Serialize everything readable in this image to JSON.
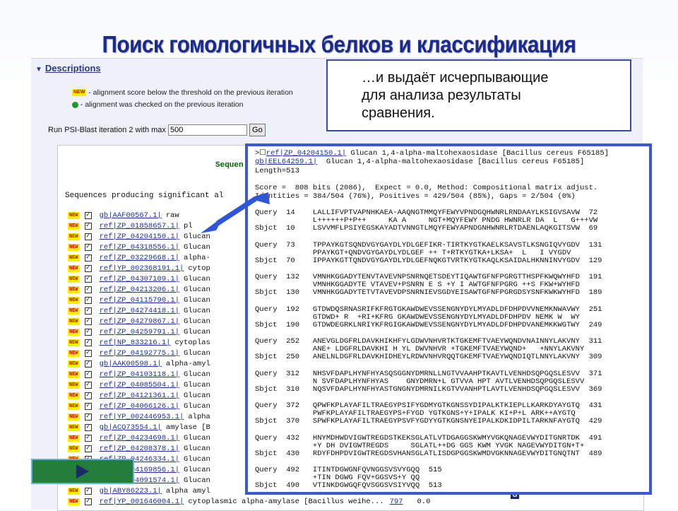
{
  "title": "Поиск гомологичных белков и классификация",
  "descriptions": {
    "label": "Descriptions",
    "legend_new_text": "- alignment score below the threshold on the previous iteration",
    "legend_checked_text": "- alignment was checked on the previous iteration",
    "new_badge": "NEW",
    "psi_label": "Run PSI-Blast iteration 2 with max",
    "psi_value": "500",
    "go_label": "Go"
  },
  "results": {
    "sequences_heading": "Sequen",
    "producing_text": "Sequences producing significant al",
    "hits": [
      {
        "acc": "gb|AAF00567.1|",
        "desc": "raw"
      },
      {
        "acc": "ref|ZP_01858657.1|",
        "desc": "pl"
      },
      {
        "acc": "ref|ZP_04204150.1|",
        "desc": "Glucan"
      },
      {
        "acc": "ref|ZP_04318556.1|",
        "desc": "Glucan"
      },
      {
        "acc": "ref|ZP_03229668.1|",
        "desc": "alpha-"
      },
      {
        "acc": "ref|YP_002368191.1|",
        "desc": "cytop"
      },
      {
        "acc": "ref|ZP_04307109.1|",
        "desc": "Glucan"
      },
      {
        "acc": "ref|ZP_04213206.1|",
        "desc": "Glucan"
      },
      {
        "acc": "ref|ZP_04115790.1|",
        "desc": "Glucan"
      },
      {
        "acc": "ref|ZP_04274418.1|",
        "desc": "Glucan"
      },
      {
        "acc": "ref|ZP_04279867.1|",
        "desc": "Glucan"
      },
      {
        "acc": "ref|ZP_04259791.1|",
        "desc": "Glucan"
      },
      {
        "acc": "ref|NP_833216.1|",
        "desc": "cytoplas"
      },
      {
        "acc": "ref|ZP_04192775.1|",
        "desc": "Glucan"
      },
      {
        "acc": "gb|AAK00598.1|",
        "desc": "alpha-amyl"
      },
      {
        "acc": "ref|ZP_04103118.1|",
        "desc": "Glucan"
      },
      {
        "acc": "ref|ZP_04085504.1|",
        "desc": "Glucan"
      },
      {
        "acc": "ref|ZP_04121361.1|",
        "desc": "Glucan"
      },
      {
        "acc": "ref|ZP_04066126.1|",
        "desc": "Glucan"
      },
      {
        "acc": "ref|YP_002446953.1|",
        "desc": "alpha"
      },
      {
        "acc": "gb|ACQ73554.1|",
        "desc": "amylase [B"
      },
      {
        "acc": "ref|ZP_04234698.1|",
        "desc": "Glucan"
      },
      {
        "acc": "ref|ZP_04208378.1|",
        "desc": "Glucan"
      },
      {
        "acc": "ref|ZP_04246334.1|",
        "desc": "Glucan"
      },
      {
        "acc": "ref|ZP_04169856.1|",
        "desc": "Glucan"
      },
      {
        "acc": "ref|ZP_04091574.1|",
        "desc": "Glucan"
      },
      {
        "acc": "gb|ABY86223.1|",
        "desc": "alpha amyl"
      },
      {
        "acc": "ref|YP_001646004.1|",
        "desc": "cytoplasmic alpha-amylase [Bacillus weihe...",
        "score": "797",
        "evalue": "0.0"
      }
    ]
  },
  "callout": {
    "lines": [
      "…и выдаёт исчерпывающие",
      "для анализа результаты",
      "сравнения."
    ]
  },
  "alignment": {
    "header_prefix": ">",
    "header_acc": "ref|ZP_04204150.1|",
    "header_desc": "Glucan 1,4-alpha-maltohexaosidase [Bacillus cereus F65185]",
    "gb_acc": "gb|EEL64259.1|",
    "gb_desc": "Glucan 1,4-alpha-maltohexaosidase [Bacillus cereus F65185]",
    "length": "Length=513",
    "score_line": "Score =  808 bits (2086),  Expect = 0.0, Method: Compositional matrix adjust.",
    "identities_line": "Identities = 384/504 (76%), Positives = 429/504 (85%), Gaps = 2/504 (0%)",
    "blocks": [
      {
        "q": "Query  14    LALLIFVPTVAPNHKAEA-AAQNGTMMQYFEWYVPNDGQHWNRLRNDAAYLKSIGVSAVW  72",
        "m": "             L++++++P+P++     KA A     NGT+MQYFEWY PNDG HWNRLR DA  L   G+++VW",
        "s": "Sbjct  10    LSVVMFLPSIYEGSKAYADTVNNGTLMQYFEWYAPNDGNHWNRLRTDAENLAQKGITSVW  69"
      },
      {
        "q": "Query  73    TPPAYKGTSQNDVGYGAYDLYDLGEFIKR-TIRTKYGTKAELKSAVSTLKSNGIQVYGDV  131",
        "m": "             PPAYKGT+QNDVGYGAYDLYDLGEF ++ T+RTKYGTKA+LKSA+  L   I VYGDV",
        "s": "Sbjct  70    IPPAYKGTTQNDVGYGAYDLYDLGEFNQKGTVRTKYGTKAQLKSAIDALHKNNINVYGDV  129"
      },
      {
        "q": "Query  132   VMNHKGGADYTENVTAVEVNPSNRNQETSDEYTIQAWTGFNFPGRGTTHSPFKWQWYHFD  191",
        "m": "             VMNHKGGADYTE VTAVEV+PSNRN E S +Y I AWTGFNFPGRG ++S FKW+WYHFD",
        "s": "Sbjct  130   VMNHKGGADYTETVTAVEVDPSNRNIEVSGDYEISAWTGFNFPGRGDSYSNFKWKWYHFD  189"
      },
      {
        "q": "Query  192   GTDWDQSRNASRIFKFRGTGKAWDWEVSSENGNYDYLMYADLDFDHPDVVNEMKNWAVWY  251",
        "m": "             GTDWD+ R  +RI+KFRG GKAWDWEVSSENGNYDYLMYADLDFDHPDV NEMK W  WY",
        "s": "Sbjct  190   GTDWDEGRKLNRIYKFRGIGKAWDWEVSSENGNYDYLMYADLDFDHPDVANEMKKWGTWY  249"
      },
      {
        "q": "Query  252   ANEVGLDGFRLDAVKHIKHFYLGDWVNHVRTKTGKEMFTVAEYWQNDVNAINNYLAKVNY  311",
        "m": "             ANE+ LDGFRLDAVKHI H YL DWVNHVR +TGKEMFTVAEYWQND+   +NNYLAKVNY",
        "s": "Sbjct  250   ANELNLDGFRLDAVKHIDHEYLRDWVNHVRQQTGKEMFTVAEYWQNDIQTLNNYLAKVNY  309"
      },
      {
        "q": "Query  312   NHSVFDAPLHYNFHYASQSGGNYDMRNLLNGTVVAAHPTKAVTLVENHDSQPGQSLESVV  371",
        "m": "             N SVFDAPLHYNFHYAS    GNYDMRN+L GTVVA HPT AVTLVENHDSQPGQSLESVV",
        "s": "Sbjct  310   NQSVFDAPLHYNFHYASTGNGNYDMRNILKGTVVANHPTLAVTLVENHDSQPGQSLESVV  369"
      },
      {
        "q": "Query  372   QPWFKPLAYAFILTRAEGYPSIFYGDMYGTKGNSSYDIPALKTKIEPLLKARKDYAYGTQ  431",
        "m": "             PWFKPLAYAFILTRAEGYPS+FYGD YGTKGNS+Y+IPALK KI+P+L ARK++AYGTQ",
        "s": "Sbjct  370   SPWFKPLAYAFILTRAEGYPSVFYGDYYGTKGNSNYEIPALKDKIDPILTARKNFAYGTQ  429"
      },
      {
        "q": "Query  432   HNYMDHWDVIGWTREGDSTKEKSGLATLVTDGAGGSKWMYVGKQNAGEVWYDITGNRTDK  491",
        "m": "             +Y DH DVIGWTREGDS     SGLATL++DG GGS KWM YVGK NAGEVWYDITGN+T+",
        "s": "Sbjct  430   RDYFDHPDVIGWTREGDSVHANSGLATLISDGPGGSKWMDVGKNNAGEVWYDITGNQTNT  489"
      },
      {
        "q": "Query  492   ITINTDGWGNFQVNGGSVSVYGQQ  515",
        "m": "             +TIN DGWG FQV+GGSVS+Y QQ",
        "s": "Sbjct  490   VTINKDGWGQFQVSGGSVSIYVQQ  513"
      }
    ]
  }
}
